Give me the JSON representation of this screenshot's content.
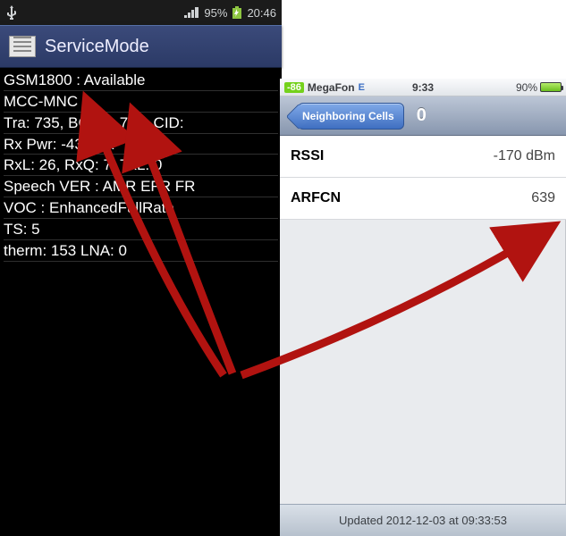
{
  "android": {
    "status": {
      "signal_pct": "95%",
      "time": "20:46"
    },
    "app_title": "ServiceMode",
    "rows": [
      "GSM1800 : Available",
      "MCC-MNC :",
      "Tra: 735, BCCH: 735, CID:",
      "Rx Pwr: -43, Dtx",
      "RxL: 26, RxQ: 7, TxL: 0",
      "Speech VER : AMR EFR FR",
      "VOC : EnhancedFullRate",
      "TS: 5",
      "therm: 153 LNA: 0"
    ]
  },
  "ios": {
    "status": {
      "signal": "-86",
      "carrier": "MegaFon",
      "network": "E",
      "time": "9:33",
      "battery_pct": "90%"
    },
    "nav": {
      "back_label": "Neighboring Cells",
      "title": "0"
    },
    "rows": [
      {
        "key": "RSSI",
        "value": "-170 dBm"
      },
      {
        "key": "ARFCN",
        "value": "639"
      }
    ],
    "footer": "Updated 2012-12-03 at 09:33:53"
  },
  "arrow_color": "#b11310"
}
